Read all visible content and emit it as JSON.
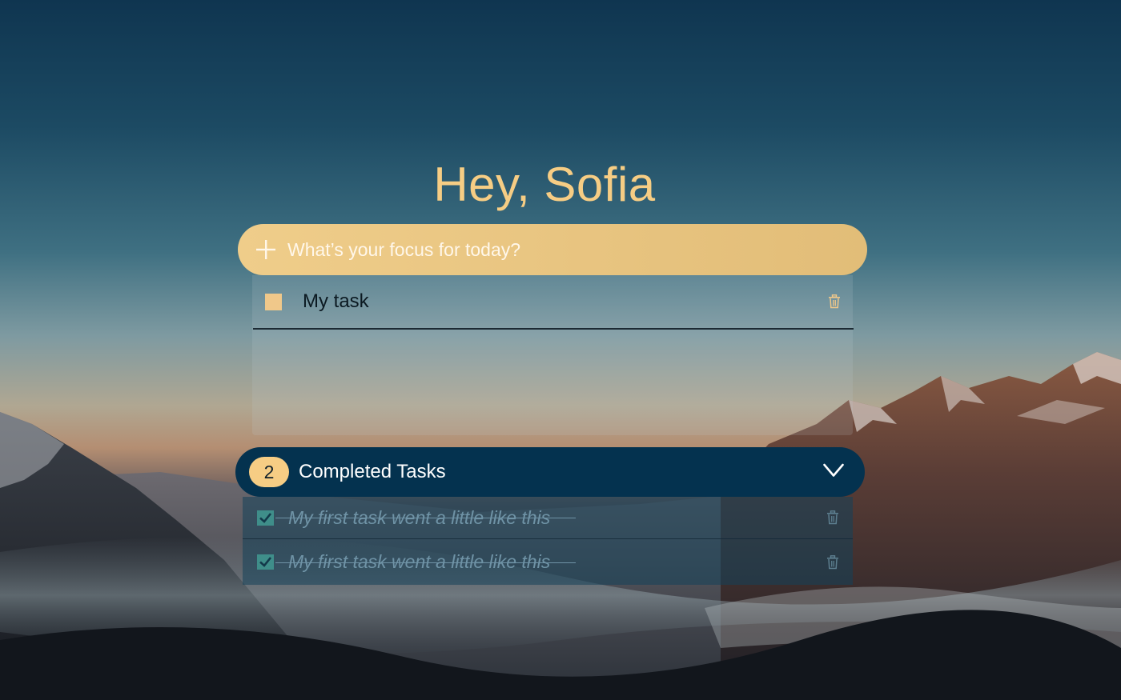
{
  "greeting": "Hey, Sofia",
  "add_task": {
    "icon": "plus-icon",
    "placeholder": "What’s your focus for today?"
  },
  "tasks": [
    {
      "label": "My task",
      "checked": false,
      "delete_icon": "trash-icon"
    }
  ],
  "completed": {
    "count": "2",
    "label": "Completed Tasks",
    "toggle_icon": "chevron-down-icon",
    "items": [
      {
        "label": "My first task went a little like this",
        "checked": true,
        "delete_icon": "trash-icon"
      },
      {
        "label": "My first task went a little like this",
        "checked": true,
        "delete_icon": "trash-icon"
      }
    ]
  },
  "colors": {
    "accent": "#f6cd84",
    "completed_header": "#04324f",
    "completed_text": "#6f93a6"
  }
}
